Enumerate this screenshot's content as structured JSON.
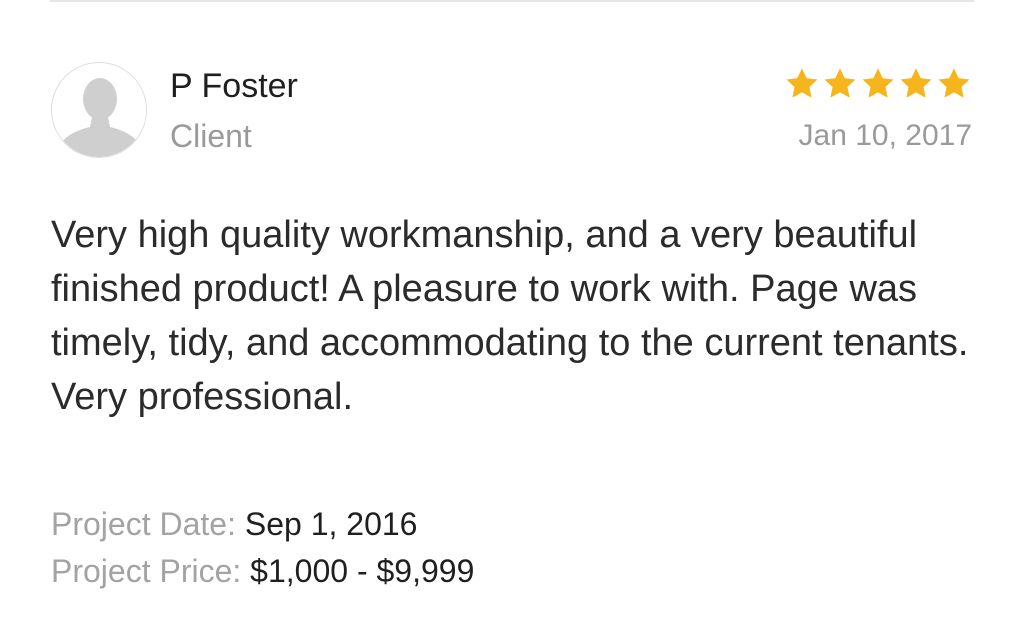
{
  "review": {
    "reviewer_name": "P Foster",
    "reviewer_role": "Client",
    "rating": 5,
    "rating_max": 5,
    "star_color": "#f7b51d",
    "date": "Jan 10, 2017",
    "text": "Very high quality workmanship, and a very beautiful finished product! A pleasure to work with. Page was timely, tidy, and accommodating to the current tenants. Very professional.",
    "avatar_icon": "person-silhouette-icon"
  },
  "project": {
    "date_label": "Project Date:",
    "date_value": "Sep 1, 2016",
    "price_label": "Project Price:",
    "price_value": "$1,000 - $9,999"
  }
}
